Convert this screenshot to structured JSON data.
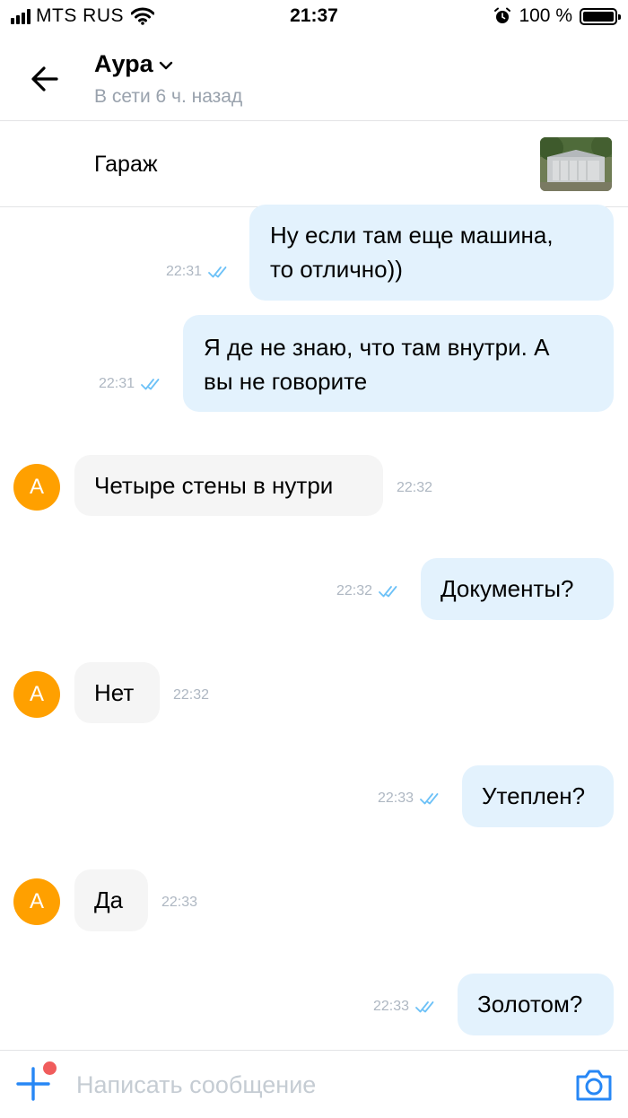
{
  "status_bar": {
    "carrier": "MTS RUS",
    "time": "21:37",
    "battery": "100 %"
  },
  "header": {
    "contact_name": "Аура",
    "presence": "В сети 6 ч. назад"
  },
  "listing": {
    "title": "Гараж"
  },
  "messages": [
    {
      "dir": "out",
      "line1": "Ну если там еще машина,",
      "line2": "то отлично))",
      "time": "22:31"
    },
    {
      "dir": "out",
      "line1": "Я де не знаю, что там внутри. А",
      "line2": "вы не говорите",
      "time": "22:31"
    },
    {
      "dir": "in",
      "avatar": "A",
      "text": "Четыре стены в нутри",
      "time": "22:32"
    },
    {
      "dir": "out",
      "text": "Документы?",
      "time": "22:32"
    },
    {
      "dir": "in",
      "avatar": "A",
      "text": "Нет",
      "time": "22:32"
    },
    {
      "dir": "out",
      "text": "Утеплен?",
      "time": "22:33"
    },
    {
      "dir": "in",
      "avatar": "A",
      "text": "Да",
      "time": "22:33"
    },
    {
      "dir": "out",
      "text": "Золотом?",
      "time": "22:33"
    }
  ],
  "composer": {
    "placeholder": "Написать сообщение"
  },
  "colors": {
    "accent": "#2787f5",
    "outgoing_bubble": "#e3f2fd",
    "incoming_bubble": "#f5f5f5",
    "avatar": "#ffa000",
    "read_ticks": "#6cc1f7",
    "notification_dot": "#f05c5c"
  },
  "icons": [
    "signal-icon",
    "wifi-icon",
    "alarm-icon",
    "battery-icon",
    "back-arrow-icon",
    "chevron-down-icon",
    "double-check-icon",
    "plus-icon",
    "camera-icon"
  ]
}
